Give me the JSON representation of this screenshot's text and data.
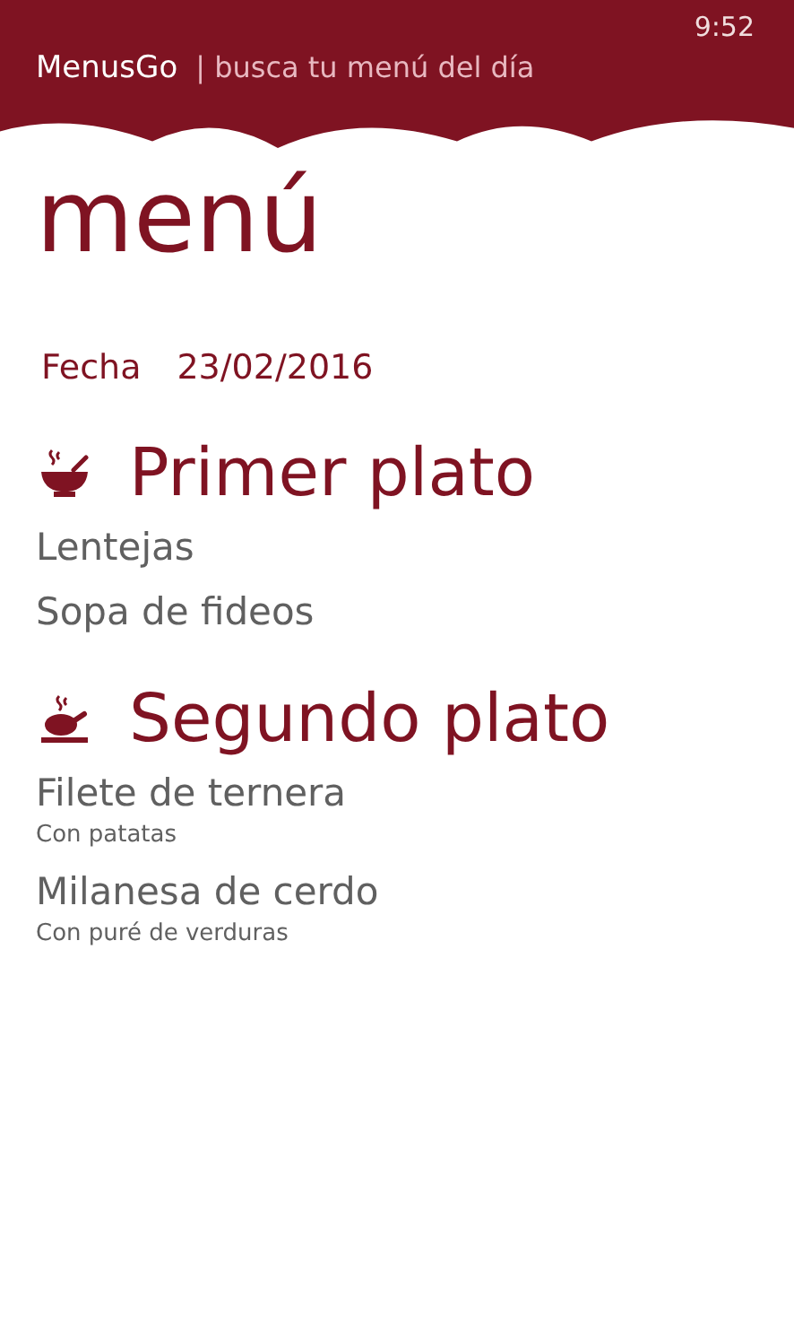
{
  "status_bar": {
    "time": "9:52"
  },
  "header": {
    "app_name": "MenusGo",
    "tagline": "| busca tu menú del día"
  },
  "page_title": "menú",
  "date": {
    "label": "Fecha",
    "value": "23/02/2016"
  },
  "sections": [
    {
      "kind": "soup",
      "title": "Primer plato",
      "items": [
        {
          "name": "Lentejas"
        },
        {
          "name": "Sopa de fideos"
        }
      ]
    },
    {
      "kind": "roast",
      "title": "Segundo plato",
      "items": [
        {
          "name": "Filete de ternera",
          "note": "Con patatas"
        },
        {
          "name": "Milanesa de cerdo",
          "note": "Con puré de verduras"
        }
      ]
    }
  ]
}
